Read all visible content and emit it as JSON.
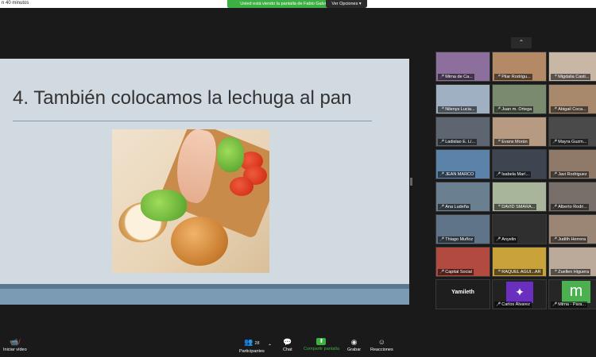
{
  "top": {
    "timer_text": "n 40 minutos",
    "share_banner": "Usted está viendo la pantalla de Fabio Galván",
    "view_options": "Ver Opciones ▾"
  },
  "slide": {
    "title": "4. También colocamos la lechuga al pan"
  },
  "gallery": {
    "participants": [
      {
        "name": "Mirna de Ca...",
        "bg": "#8c6f9c"
      },
      {
        "name": "Pilar Rodrigu...",
        "bg": "#b48a66"
      },
      {
        "name": "Migdalia Casti...",
        "bg": "#c9b7a6"
      },
      {
        "name": "Nilenys Lucia...",
        "bg": "#9fb0c2"
      },
      {
        "name": "Juan m. Ortega",
        "bg": "#7a8a6e"
      },
      {
        "name": "Abigail Coca...",
        "bg": "#a8896b"
      },
      {
        "name": "Ladislao E. Lí...",
        "bg": "#5d6670"
      },
      {
        "name": "Evans Morán",
        "bg": "#b79a82"
      },
      {
        "name": "Mayra Guzm...",
        "bg": "#4a4a4a"
      },
      {
        "name": "JEAN MARCO",
        "bg": "#5b82a8"
      },
      {
        "name": "Isabela Marí...",
        "bg": "#3d4550"
      },
      {
        "name": "Javi Rodriguez",
        "bg": "#8f7a6a"
      },
      {
        "name": "Ana Ludeña",
        "bg": "#6a7f8f"
      },
      {
        "name": "DAVID SMARA...",
        "bg": "#a9b59a"
      },
      {
        "name": "Alberto Rodri...",
        "bg": "#786f6a"
      },
      {
        "name": "Thiago Muñoz",
        "bg": "#5f7488"
      },
      {
        "name": "Anyelin",
        "bg": "#2f2f2f"
      },
      {
        "name": "Judith Herrera",
        "bg": "#9b8575"
      },
      {
        "name": "Capital Social",
        "bg": "#b24a3f"
      },
      {
        "name": "RAQUEL AGUI...AR",
        "bg": "#c9a23a"
      },
      {
        "name": "Zuellen Higuera",
        "bg": "#bba99a"
      },
      {
        "name": "Yamileth",
        "bg": "#1e1e1e",
        "big": true
      },
      {
        "name": "Carlos Álvarez",
        "bg": "#222222",
        "logo": true
      },
      {
        "name": "Mirna - Para...",
        "bg": "#262626",
        "initial": "m"
      }
    ]
  },
  "toolbar": {
    "video_label": "Iniciar vídeo",
    "participants_label": "Participantes",
    "participants_count": "28",
    "chat_label": "Chat",
    "share_label": "Compartir pantalla",
    "record_label": "Grabar",
    "reactions_label": "Reacciones",
    "colors": {
      "share": "#3cb043",
      "muted": "#e23b3b"
    }
  }
}
